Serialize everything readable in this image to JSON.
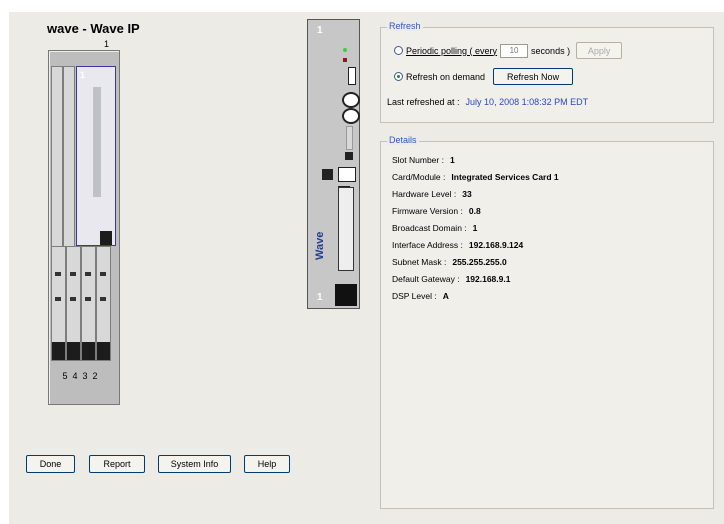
{
  "chassis": {
    "title": "wave - Wave IP",
    "top_slot_number": "1",
    "selected_slot_number": "1",
    "slot_numbers": [
      "5",
      "4",
      "3",
      "2"
    ]
  },
  "card_view": {
    "top_number": "1",
    "bottom_number": "1",
    "brand": "Wave"
  },
  "refresh": {
    "title": "Refresh",
    "periodic_label": "Periodic polling  ( every",
    "interval_value": "10",
    "seconds_label": "seconds )",
    "apply_label": "Apply",
    "on_demand_label": "Refresh on demand",
    "refresh_now_label": "Refresh Now",
    "last_refreshed_label": "Last refreshed at :",
    "last_refreshed_value": "July 10, 2008 1:08:32 PM EDT",
    "selected_mode": "on_demand"
  },
  "details": {
    "title": "Details",
    "rows": [
      {
        "label": "Slot Number :",
        "value": "1"
      },
      {
        "label": "Card/Module :",
        "value": "Integrated Services Card 1"
      },
      {
        "label": "Hardware Level :",
        "value": "33"
      },
      {
        "label": "Firmware Version :",
        "value": "0.8"
      },
      {
        "label": "Broadcast Domain :",
        "value": "1"
      },
      {
        "label": "Interface Address :",
        "value": "192.168.9.124"
      },
      {
        "label": "Subnet Mask :",
        "value": "255.255.255.0"
      },
      {
        "label": "Default Gateway :",
        "value": "192.168.9.1"
      },
      {
        "label": "DSP Level :",
        "value": "A"
      }
    ]
  },
  "buttons": {
    "done": "Done",
    "report": "Report",
    "system_info": "System Info",
    "help": "Help"
  },
  "colors": {
    "accent_blue": "#2b48b8",
    "panel": "#ecebe5",
    "brand_blue": "#243c8e"
  }
}
